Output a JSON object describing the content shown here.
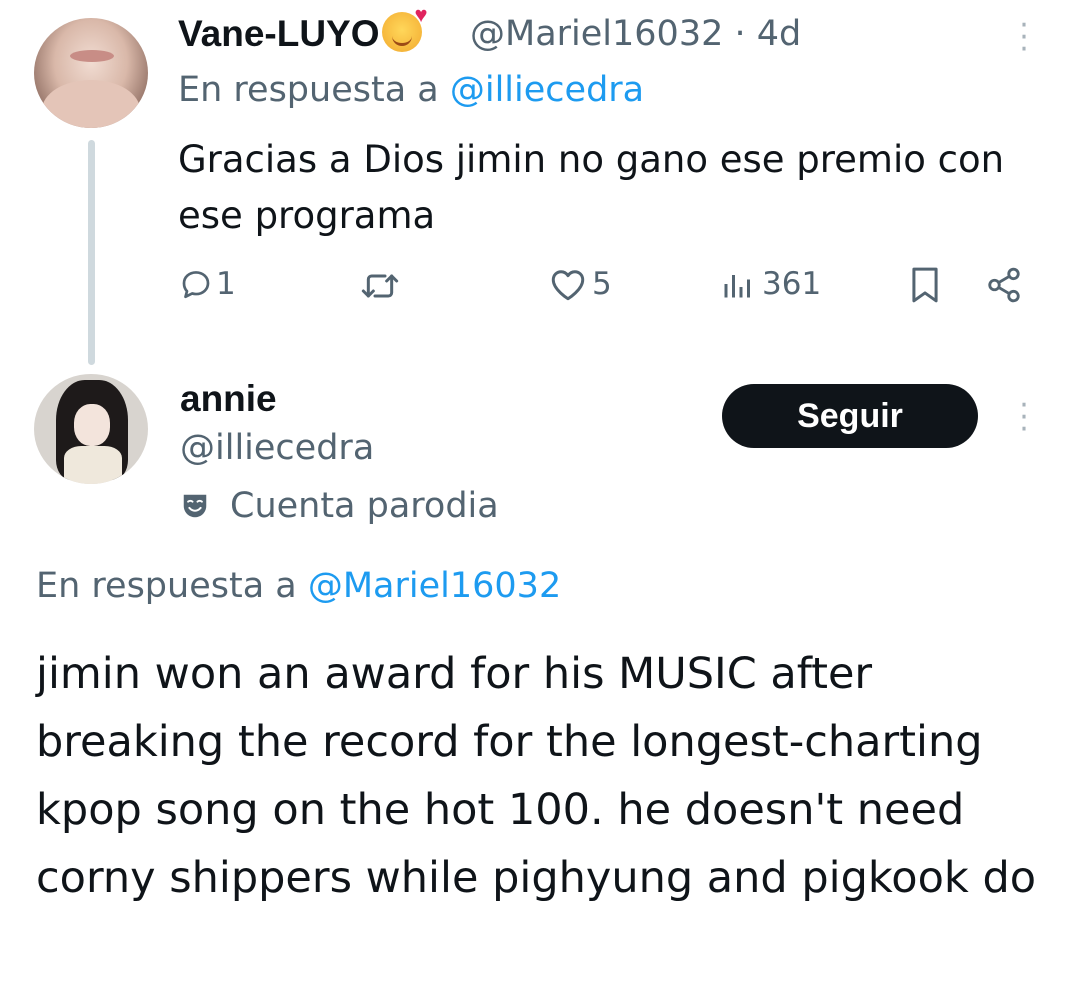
{
  "tweet1": {
    "display_name": "Vane-LUYO",
    "emoji": "smiling-face-with-hearts-emoji",
    "handle": "@Mariel16032",
    "separator": "·",
    "time": "4d",
    "reply_prefix": "En respuesta a ",
    "reply_to": "@illiecedra",
    "text": "Gracias a Dios jimin no gano ese premio con ese programa",
    "stats": {
      "replies": "1",
      "likes": "5",
      "views": "361"
    }
  },
  "tweet2": {
    "display_name": "annie",
    "handle": "@illiecedra",
    "badge_label": "Cuenta parodia",
    "follow_label": "Seguir",
    "reply_prefix": "En respuesta a ",
    "reply_to": "@Mariel16032",
    "text": "jimin won an award for his MUSIC after breaking the record for the longest-charting kpop song on the hot 100. he doesn't need corny shippers while pighyung and pigkook do"
  },
  "colors": {
    "text_primary": "#0f1419",
    "text_secondary": "#536471",
    "link": "#1d9bf0",
    "button_bg": "#0f1419",
    "button_text": "#ffffff",
    "thread_line": "#cfd9de"
  }
}
